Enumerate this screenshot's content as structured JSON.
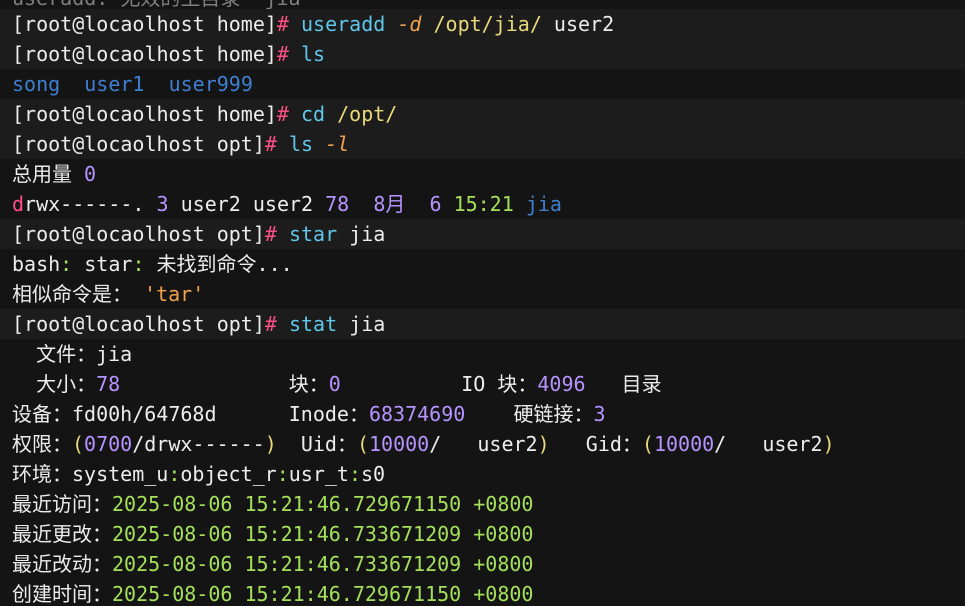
{
  "terminal": {
    "top_cut": "useradd: 无效的主目录 'jia'",
    "prompt_home": "[root@locaolhost home]",
    "prompt_opt": "[root@locaolhost opt]",
    "hash": "#",
    "cmd1": {
      "name": "useradd",
      "flag": "-d",
      "path": "/opt/jia/",
      "arg": "user2"
    },
    "cmd2": {
      "name": "ls"
    },
    "ls_out": [
      "song",
      "user1",
      "user999"
    ],
    "cmd3": {
      "name": "cd",
      "arg": "/opt/"
    },
    "cmd4": {
      "name": "ls",
      "flag": "-l"
    },
    "total": {
      "label": "总用量",
      "value": "0"
    },
    "entry": {
      "perm_d": "d",
      "perm_rest": "rwx------.",
      "links": "3",
      "owner": "user2",
      "group": "user2",
      "size": "78",
      "month": "8月",
      "day": "6",
      "time": "15:21",
      "name": "jia"
    },
    "cmd5": {
      "name": "star",
      "arg": "jia"
    },
    "err1": {
      "a": "bash",
      "b": "star",
      "c": "未找到命令..."
    },
    "sugg": {
      "label": "相似命令是：",
      "value": "'tar'"
    },
    "cmd6": {
      "name": "stat",
      "arg": "jia"
    },
    "stat": {
      "file_label": "文件：",
      "file": "jia",
      "size_label": "大小：",
      "size": "78",
      "blocks_label": "块：",
      "blocks": "0",
      "io_label": "IO 块：",
      "io": "4096",
      "type": "目录",
      "device_label": "设备：",
      "device": "fd00h/64768d",
      "inode_label": "Inode：",
      "inode": "68374690",
      "links_label": "硬链接：",
      "links": "3",
      "perm_label": "权限：",
      "perm_num": "0700",
      "perm_str": "drwx------",
      "uid_label": "Uid：",
      "uid": "10000",
      "uid_name": "user2",
      "gid_label": "Gid：",
      "gid": "10000",
      "gid_name": "user2",
      "ctx_label": "环境：",
      "ctx": [
        "system_u",
        "object_r",
        "usr_t",
        "s0"
      ],
      "times": [
        {
          "label": "最近访问：",
          "date": "2025-08-06",
          "time": "15:21:46.729671150",
          "tz": "+0800"
        },
        {
          "label": "最近更改：",
          "date": "2025-08-06",
          "time": "15:21:46.733671209",
          "tz": "+0800"
        },
        {
          "label": "最近改动：",
          "date": "2025-08-06",
          "time": "15:21:46.733671209",
          "tz": "+0800"
        },
        {
          "label": "创建时间：",
          "date": "2025-08-06",
          "time": "15:21:46.729671150",
          "tz": "+0800"
        }
      ]
    }
  }
}
